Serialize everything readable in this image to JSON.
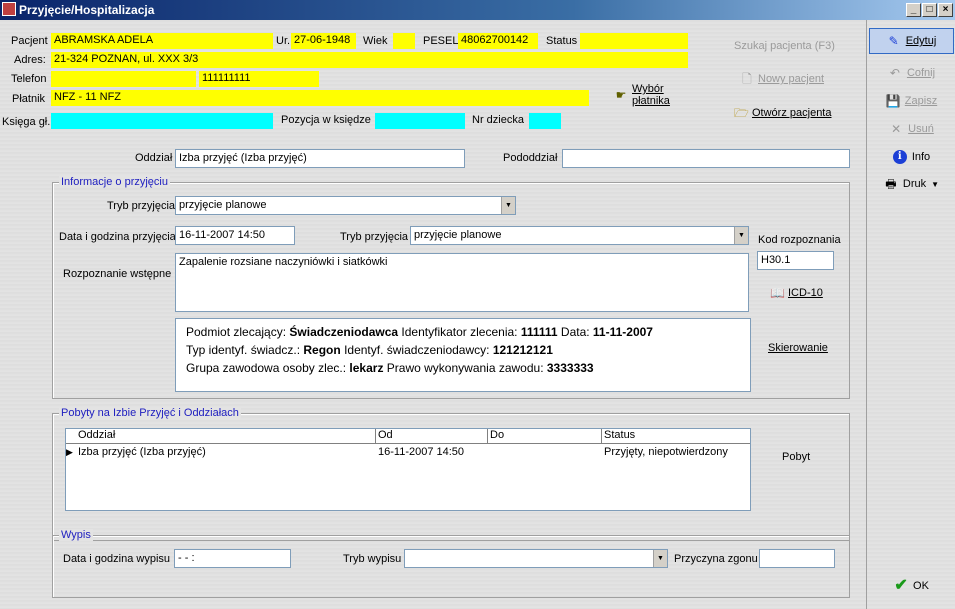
{
  "window": {
    "title": "Przyjęcie/Hospitalizacja",
    "min_symbol": "_",
    "max_symbol": "□",
    "close_symbol": "×"
  },
  "patient": {
    "pacjent_label": "Pacjent",
    "pacjent_value": "ABRAMSKA ADELA",
    "ur_label": "Ur.",
    "ur_value": "27-06-1948",
    "wiek_label": "Wiek",
    "wiek_value": "",
    "pesel_label": "PESEL",
    "pesel_value": "48062700142",
    "status_label": "Status",
    "status_value": "",
    "adres_label": "Adres:",
    "adres_value": "21-324 POZNAN, ul. XXX 3/3",
    "telefon_label": "Telefon",
    "telefon_value": "",
    "telefon_value2": "111111111",
    "platnik_label": "Płatnik",
    "platnik_value": "NFZ - 11 NFZ",
    "wybor_platnika": "Wybór płatnika",
    "ksiega_label": "Księga gł.",
    "ksiega_value": "",
    "pozycja_label": "Pozycja w księdze",
    "pozycja_value": "",
    "nr_dziecka_label": "Nr dziecka",
    "nr_dziecka_value": ""
  },
  "patient_actions": {
    "szukaj": "Szukaj pacjenta (F3)",
    "nowy": "Nowy pacjent",
    "otworz": "Otwórz pacjenta"
  },
  "oddzial": {
    "oddzial_label": "Oddział",
    "oddzial_value": "Izba przyjęć (Izba przyjęć)",
    "pododdzial_label": "Pododdział",
    "pododdzial_value": ""
  },
  "przyjecie": {
    "group_title": "Informacje o przyjęciu",
    "tryb_label": "Tryb przyjęcia",
    "tryb_value": "przyjęcie planowe",
    "data_label": "Data i godzina przyjęcia",
    "data_value": "16-11-2007 14:50",
    "tryb2_label": "Tryb przyjęcia",
    "tryb2_value": "przyjęcie planowe",
    "kod_label": "Kod rozpoznania",
    "kod_value": "H30.1",
    "rozpoznanie_label": "Rozpoznanie wstępne",
    "rozpoznanie_value": "Zapalenie rozsiane naczyniówki i siatkówki",
    "icd_label": "ICD-10",
    "skierowanie_label": "Skierowanie",
    "info_line1_a": "Podmiot zlecający: ",
    "info_line1_b": "Świadczeniodawca",
    "info_line1_c": "  Identyfikator zlecenia: ",
    "info_line1_d": "111111",
    "info_line1_e": "  Data: ",
    "info_line1_f": "11-11-2007",
    "info_line2_a": "Typ identyf. świadcz.: ",
    "info_line2_b": "Regon",
    "info_line2_c": "  Identyf. świadczeniodawcy: ",
    "info_line2_d": "121212121",
    "info_line3_a": "Grupa zawodowa osoby zlec.: ",
    "info_line3_b": "lekarz",
    "info_line3_c": "  Prawo wykonywania zawodu: ",
    "info_line3_d": "3333333"
  },
  "pobyty": {
    "group_title": "Pobyty na Izbie Przyjęć i Oddziałach",
    "columns": [
      "Oddział",
      "Od",
      "Do",
      "Status"
    ],
    "rows": [
      [
        "Izba przyjęć (Izba przyjęć)",
        "16-11-2007 14:50",
        "",
        "Przyjęty, niepotwierdzony"
      ]
    ],
    "pobyt_button": "Pobyt"
  },
  "wypis": {
    "group_title": "Wypis",
    "data_label": "Data i godzina wypisu",
    "data_value": " -  -        :",
    "tryb_label": "Tryb wypisu",
    "tryb_value": "",
    "przyczyna_label": "Przyczyna zgonu",
    "przyczyna_value": ""
  },
  "toolbar": {
    "edytuj": "Edytuj",
    "cofnij": "Cofnij",
    "zapisz": "Zapisz",
    "usun": "Usuń",
    "info": "Info",
    "druk": "Druk",
    "ok": "OK"
  }
}
